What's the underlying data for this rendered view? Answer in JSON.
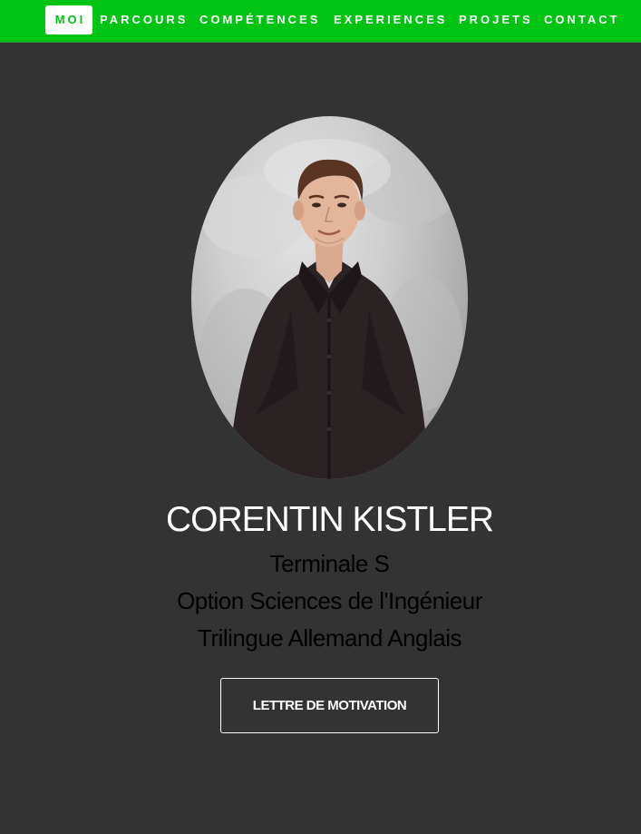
{
  "nav": {
    "items": [
      {
        "label": "MOI",
        "active": true
      },
      {
        "label": "PARCOURS"
      },
      {
        "label": "COMPÉTENCES"
      },
      {
        "label": "EXPERIENCES"
      },
      {
        "label": "PROJETS"
      },
      {
        "label": "CONTACT"
      }
    ]
  },
  "hero": {
    "name": "CORENTIN KISTLER",
    "lines": [
      "Terminale S",
      "Option Sciences de l'Ingénieur",
      "Trilingue Allemand Anglais"
    ],
    "cta_label": "LETTRE DE MOTIVATION"
  },
  "colors": {
    "nav_background": "#00c413",
    "page_background": "#333333",
    "title_text": "#ffffff",
    "subtitle_text": "#000000"
  }
}
